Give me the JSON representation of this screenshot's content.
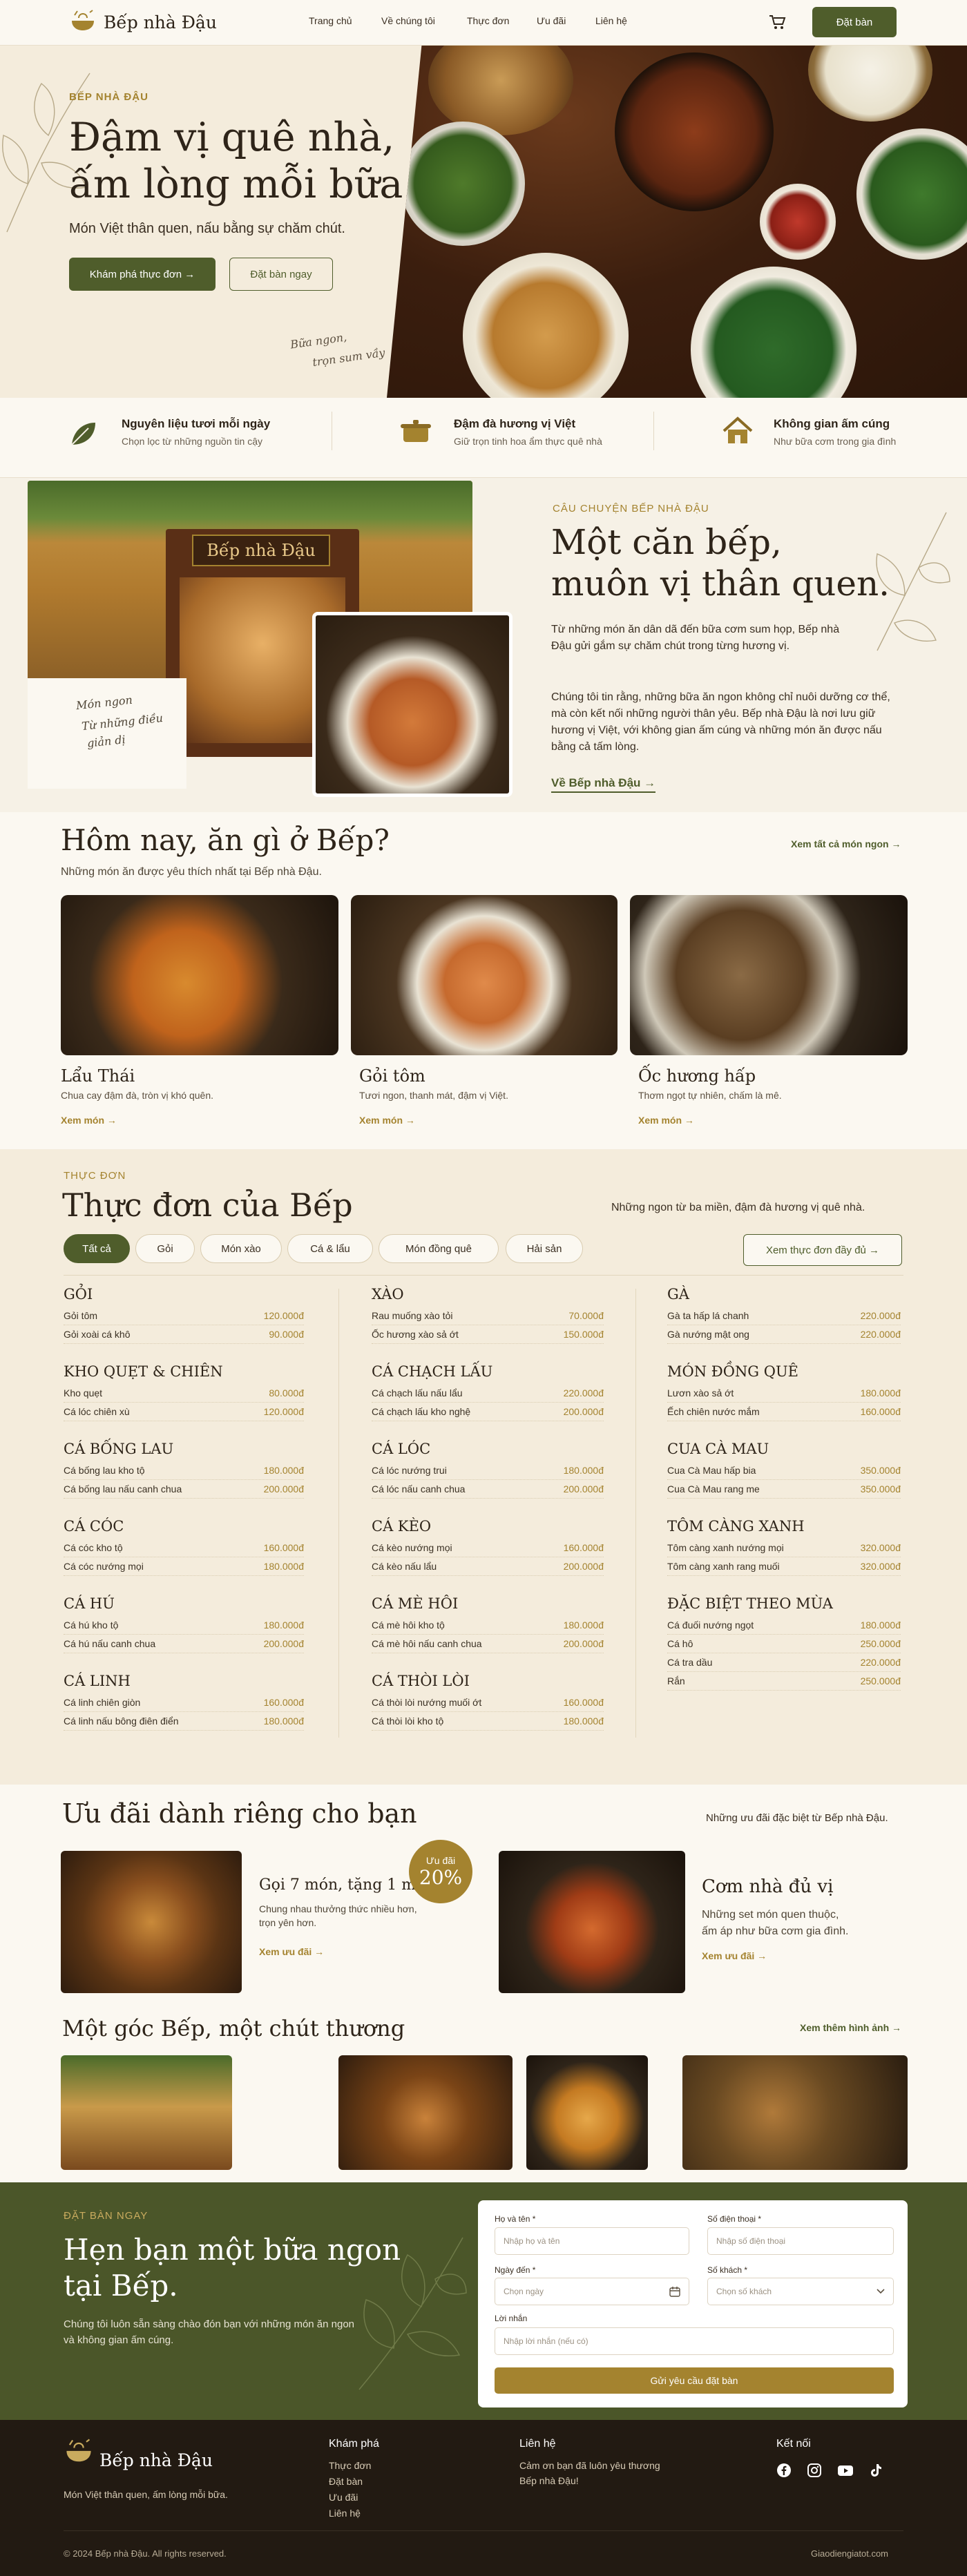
{
  "header": {
    "brand": "Bếp nhà Đậu",
    "nav": [
      "Trang chủ",
      "Về chúng tôi",
      "Thực đơn",
      "Ưu đãi",
      "Liên hệ"
    ],
    "cta": "Đặt bàn"
  },
  "hero": {
    "eyebrow": "BẾP NHÀ ĐẬU",
    "title_1": "Đậm vị quê nhà,",
    "title_2": "ấm lòng mỗi bữa.",
    "subtitle": "Món Việt thân quen, nấu bằng sự chăm chút.",
    "primary": "Khám phá thực đơn →",
    "secondary": "Đặt bàn ngay",
    "script_1": "Bữa ngon,",
    "script_2": "trọn sum vầy"
  },
  "features": [
    {
      "title": "Nguyên liệu tươi mỗi ngày",
      "desc": "Chọn lọc từ những nguồn tin cậy",
      "icon": "leaf-icon"
    },
    {
      "title": "Đậm đà hương vị Việt",
      "desc": "Giữ trọn tinh hoa ẩm thực quê nhà",
      "icon": "pot-icon"
    },
    {
      "title": "Không gian ấm cúng",
      "desc": "Như bữa cơm trong gia đình",
      "icon": "home-icon"
    }
  ],
  "story": {
    "sign": "Bếp nhà Đậu",
    "note_1": "Món ngon",
    "note_2": "Từ những điều",
    "note_3": "giản dị",
    "eyebrow": "CÂU CHUYỆN BẾP NHÀ ĐẬU",
    "title_1": "Một căn bếp,",
    "title_2": "muôn vị thân quen.",
    "p1": "Từ những món ăn dân dã đến bữa cơm sum họp, Bếp nhà Đậu gửi gắm sự chăm chút trong từng hương vị.",
    "p2": "Chúng tôi tin rằng, những bữa ăn ngon không chỉ nuôi dưỡng cơ thể, mà còn kết nối những người thân yêu. Bếp nhà Đậu là nơi lưu giữ hương vị Việt, với không gian ấm cúng và những món ăn được nấu bằng cả tấm lòng.",
    "link": "Về Bếp nhà Đậu →"
  },
  "today": {
    "title": "Hôm nay, ăn gì ở Bếp?",
    "subtitle": "Những món ăn được yêu thích nhất tại Bếp nhà Đậu.",
    "all_link": "Xem tất cả món ngon →",
    "dishes": [
      {
        "name": "Lẩu Thái",
        "desc": "Chua cay đậm đà, tròn vị khó quên.",
        "link": "Xem món →"
      },
      {
        "name": "Gỏi tôm",
        "desc": "Tươi ngon, thanh mát, đậm vị Việt.",
        "link": "Xem món →"
      },
      {
        "name": "Ốc hương hấp",
        "desc": "Thơm ngọt tự nhiên, chấm là mê.",
        "link": "Xem món →"
      }
    ]
  },
  "menu": {
    "eyebrow": "THỰC ĐƠN",
    "title": "Thực đơn của Bếp",
    "note": "Những ngon từ ba miền, đậm đà hương vị quê nhà.",
    "full_btn": "Xem thực đơn đầy đủ →",
    "chips": [
      "Tất cả",
      "Gỏi",
      "Món xào",
      "Cá & lẩu",
      "Món đồng quê",
      "Hải sản"
    ],
    "columns": [
      [
        {
          "name": "GỎI",
          "items": [
            [
              "Gỏi tôm",
              "120.000đ"
            ],
            [
              "Gỏi xoài cá khô",
              "90.000đ"
            ]
          ]
        },
        {
          "name": "KHO QUẸT & CHIÊN",
          "items": [
            [
              "Kho quẹt",
              "80.000đ"
            ],
            [
              "Cá lóc chiên xù",
              "120.000đ"
            ]
          ]
        },
        {
          "name": "CÁ BỐNG LAU",
          "items": [
            [
              "Cá bống lau kho tộ",
              "180.000đ"
            ],
            [
              "Cá bống lau nấu canh chua",
              "200.000đ"
            ]
          ]
        },
        {
          "name": "CÁ CÓC",
          "items": [
            [
              "Cá cóc kho tộ",
              "160.000đ"
            ],
            [
              "Cá cóc nướng mọi",
              "180.000đ"
            ]
          ]
        },
        {
          "name": "CÁ HÚ",
          "items": [
            [
              "Cá hú kho tộ",
              "180.000đ"
            ],
            [
              "Cá hú nấu canh chua",
              "200.000đ"
            ]
          ]
        },
        {
          "name": "CÁ LINH",
          "items": [
            [
              "Cá linh chiên giòn",
              "160.000đ"
            ],
            [
              "Cá linh nấu bông điên điển",
              "180.000đ"
            ]
          ]
        }
      ],
      [
        {
          "name": "XÀO",
          "items": [
            [
              "Rau muống xào tỏi",
              "70.000đ"
            ],
            [
              "Ốc hương xào sả ớt",
              "150.000đ"
            ]
          ]
        },
        {
          "name": "CÁ CHẠCH LẤU",
          "items": [
            [
              "Cá chạch lấu nấu lẩu",
              "220.000đ"
            ],
            [
              "Cá chạch lấu kho nghệ",
              "200.000đ"
            ]
          ]
        },
        {
          "name": "CÁ LÓC",
          "items": [
            [
              "Cá lóc nướng trui",
              "180.000đ"
            ],
            [
              "Cá lóc nấu canh chua",
              "200.000đ"
            ]
          ]
        },
        {
          "name": "CÁ KÈO",
          "items": [
            [
              "Cá kèo nướng mọi",
              "160.000đ"
            ],
            [
              "Cá kèo nấu lẩu",
              "200.000đ"
            ]
          ]
        },
        {
          "name": "CÁ MÈ HÔI",
          "items": [
            [
              "Cá mè hôi kho tộ",
              "180.000đ"
            ],
            [
              "Cá mè hôi nấu canh chua",
              "200.000đ"
            ]
          ]
        },
        {
          "name": "CÁ THÒI LÒI",
          "items": [
            [
              "Cá thòi lòi nướng muối ớt",
              "160.000đ"
            ],
            [
              "Cá thòi lòi kho tộ",
              "180.000đ"
            ]
          ]
        }
      ],
      [
        {
          "name": "GÀ",
          "items": [
            [
              "Gà ta hấp lá chanh",
              "220.000đ"
            ],
            [
              "Gà nướng mật ong",
              "220.000đ"
            ]
          ]
        },
        {
          "name": "MÓN ĐỒNG QUÊ",
          "items": [
            [
              "Lươn xào sả ớt",
              "180.000đ"
            ],
            [
              "Ếch chiên nước mắm",
              "160.000đ"
            ]
          ]
        },
        {
          "name": "CUA CÀ MAU",
          "items": [
            [
              "Cua Cà Mau hấp bia",
              "350.000đ"
            ],
            [
              "Cua Cà Mau rang me",
              "350.000đ"
            ]
          ]
        },
        {
          "name": "TÔM CÀNG XANH",
          "items": [
            [
              "Tôm càng xanh nướng mọi",
              "320.000đ"
            ],
            [
              "Tôm càng xanh rang muối",
              "320.000đ"
            ]
          ]
        },
        {
          "name": "ĐẶC BIỆT THEO MÙA",
          "items": [
            [
              "Cá đuối nướng ngọt",
              "180.000đ"
            ],
            [
              "Cá hô",
              "250.000đ"
            ],
            [
              "Cá tra dầu",
              "220.000đ"
            ],
            [
              "Rắn",
              "250.000đ"
            ]
          ]
        }
      ]
    ]
  },
  "offers": {
    "title": "Ưu đãi dành riêng cho bạn",
    "note": "Những ưu đãi đặc biệt từ Bếp nhà Đậu.",
    "o1_title": "Gọi 7 món, tặng 1 món",
    "o1_desc_1": "Chung nhau thưởng thức nhiều hơn,",
    "o1_desc_2": "trọn yên hơn.",
    "o1_link": "Xem ưu đãi →",
    "badge_top": "Ưu đãi",
    "badge_val": "20%",
    "o2_title": "Cơm nhà đủ vị",
    "o2_desc_1": "Những set món quen thuộc,",
    "o2_desc_2": "ấm áp như bữa cơm gia đình.",
    "o2_link": "Xem ưu đãi →"
  },
  "gallery": {
    "title": "Một góc Bếp, một chút thương",
    "link": "Xem thêm hình ảnh →"
  },
  "booking": {
    "eyebrow": "ĐẶT BÀN NGAY",
    "title_1": "Hẹn bạn một bữa ngon",
    "title_2": "tại Bếp.",
    "desc": "Chúng tôi luôn sẵn sàng chào đón bạn với những món ăn ngon và không gian ấm cúng.",
    "name_label": "Họ và tên *",
    "name_ph": "Nhập họ và tên",
    "phone_label": "Số điện thoại *",
    "phone_ph": "Nhập số điện thoại",
    "date_label": "Ngày đến *",
    "date_ph": "Chọn ngày",
    "guests_label": "Số khách *",
    "guests_ph": "Chọn số khách",
    "msg_label": "Lời nhắn",
    "msg_ph": "Nhập lời nhắn (nếu có)",
    "submit": "Gửi yêu cầu đặt bàn"
  },
  "footer": {
    "brand": "Bếp nhà Đậu",
    "tagline": "Món Việt thân quen, ấm lòng mỗi bữa.",
    "explore_title": "Khám phá",
    "explore": [
      "Thực đơn",
      "Đặt bàn",
      "Ưu đãi",
      "Liên hệ"
    ],
    "contact_title": "Liên hệ",
    "contact_1": "Cảm ơn bạn đã luôn yêu thương",
    "contact_2": "Bếp nhà Đậu!",
    "social_title": "Kết nối",
    "copyright": "© 2024 Bếp nhà Đậu. All rights reserved.",
    "credit": "Giaodiengiatot.com"
  }
}
